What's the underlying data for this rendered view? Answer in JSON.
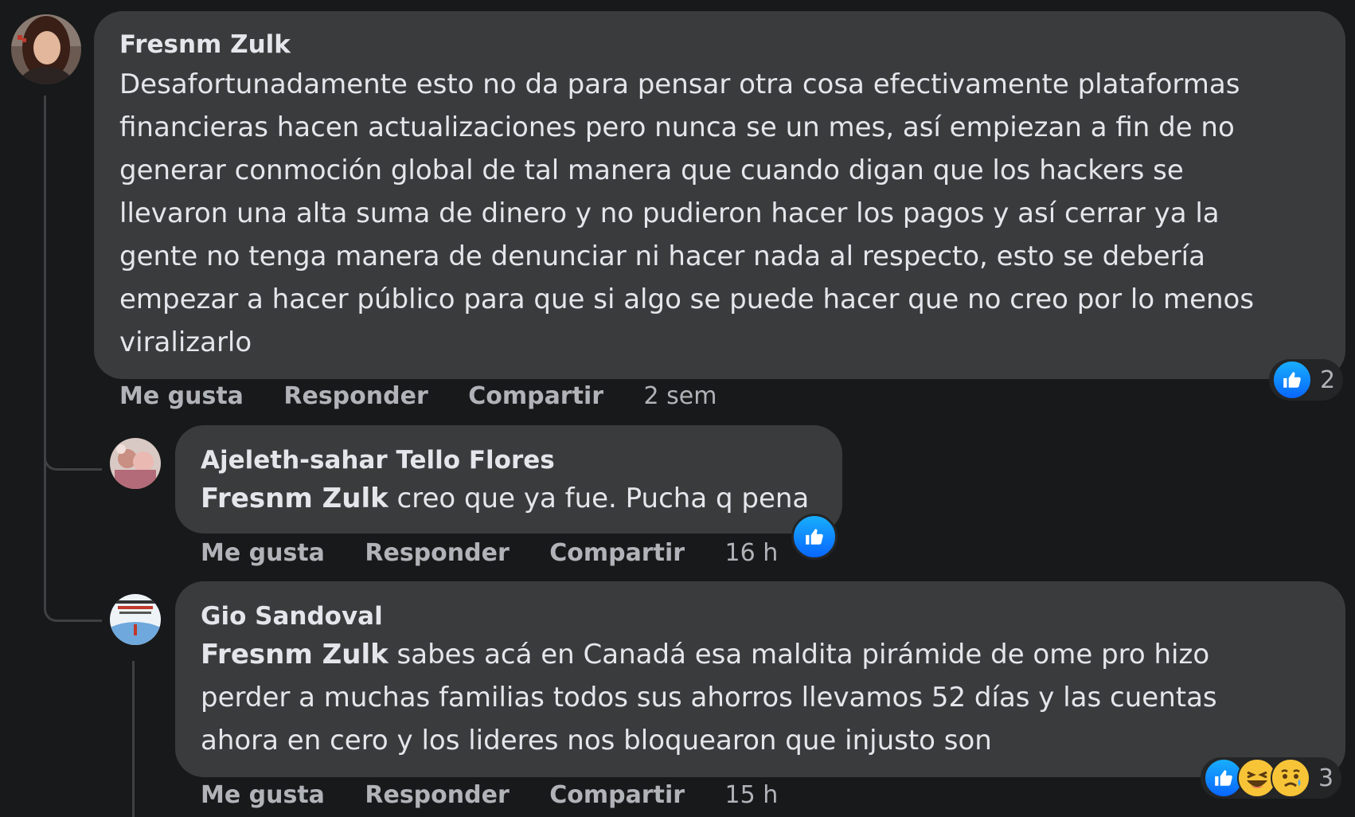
{
  "comments": [
    {
      "author": "Fresnm Zulk",
      "text_lines": [
        "Desafortunadamente esto no da para pensar otra cosa efectivamente plataformas",
        "financieras hacen actualizaciones pero nunca se un mes, así empiezan a fin de no",
        "generar conmoción global de tal manera que cuando digan que los hackers se",
        "llevaron una alta suma de dinero y no pudieron hacer los pagos y así cerrar ya la",
        "gente no tenga manera de denunciar ni hacer nada al respecto, esto se debería",
        "empezar a hacer público para que si algo se puede hacer que no creo por lo menos",
        "viralizarlo"
      ],
      "actions": {
        "like": "Me gusta",
        "reply": "Responder",
        "share": "Compartir",
        "time": "2 sem"
      },
      "reactions": {
        "icons": [
          "like-icon"
        ],
        "count": "2"
      }
    }
  ],
  "replies": [
    {
      "author": "Ajeleth-sahar Tello Flores",
      "mention": "Fresnm Zulk",
      "text_lines": [
        " creo que ya fue. Pucha q pena"
      ],
      "actions": {
        "like": "Me gusta",
        "reply": "Responder",
        "share": "Compartir",
        "time": "16 h"
      },
      "reactions": {
        "icons": [
          "like-icon"
        ]
      }
    },
    {
      "author": "Gio Sandoval",
      "mention": "Fresnm Zulk",
      "text_lines": [
        " sabes acá en Canadá esa maldita pirámide de ome pro hizo",
        "perder a muchas familias todos sus ahorros llevamos 52 días y las cuentas",
        "ahora en cero y los lideres nos bloquearon que injusto son"
      ],
      "actions": {
        "like": "Me gusta",
        "reply": "Responder",
        "share": "Compartir",
        "time": "15 h"
      },
      "reactions": {
        "icons": [
          "like-icon",
          "haha-icon",
          "sad-icon"
        ],
        "count": "3"
      }
    }
  ],
  "colors": {
    "background": "#18191a",
    "bubble": "#3a3b3c",
    "text": "#e4e6eb",
    "secondary_text": "#b0b3b8",
    "like_blue": "#0866ff",
    "emoji_yellow": "#f7c438"
  }
}
